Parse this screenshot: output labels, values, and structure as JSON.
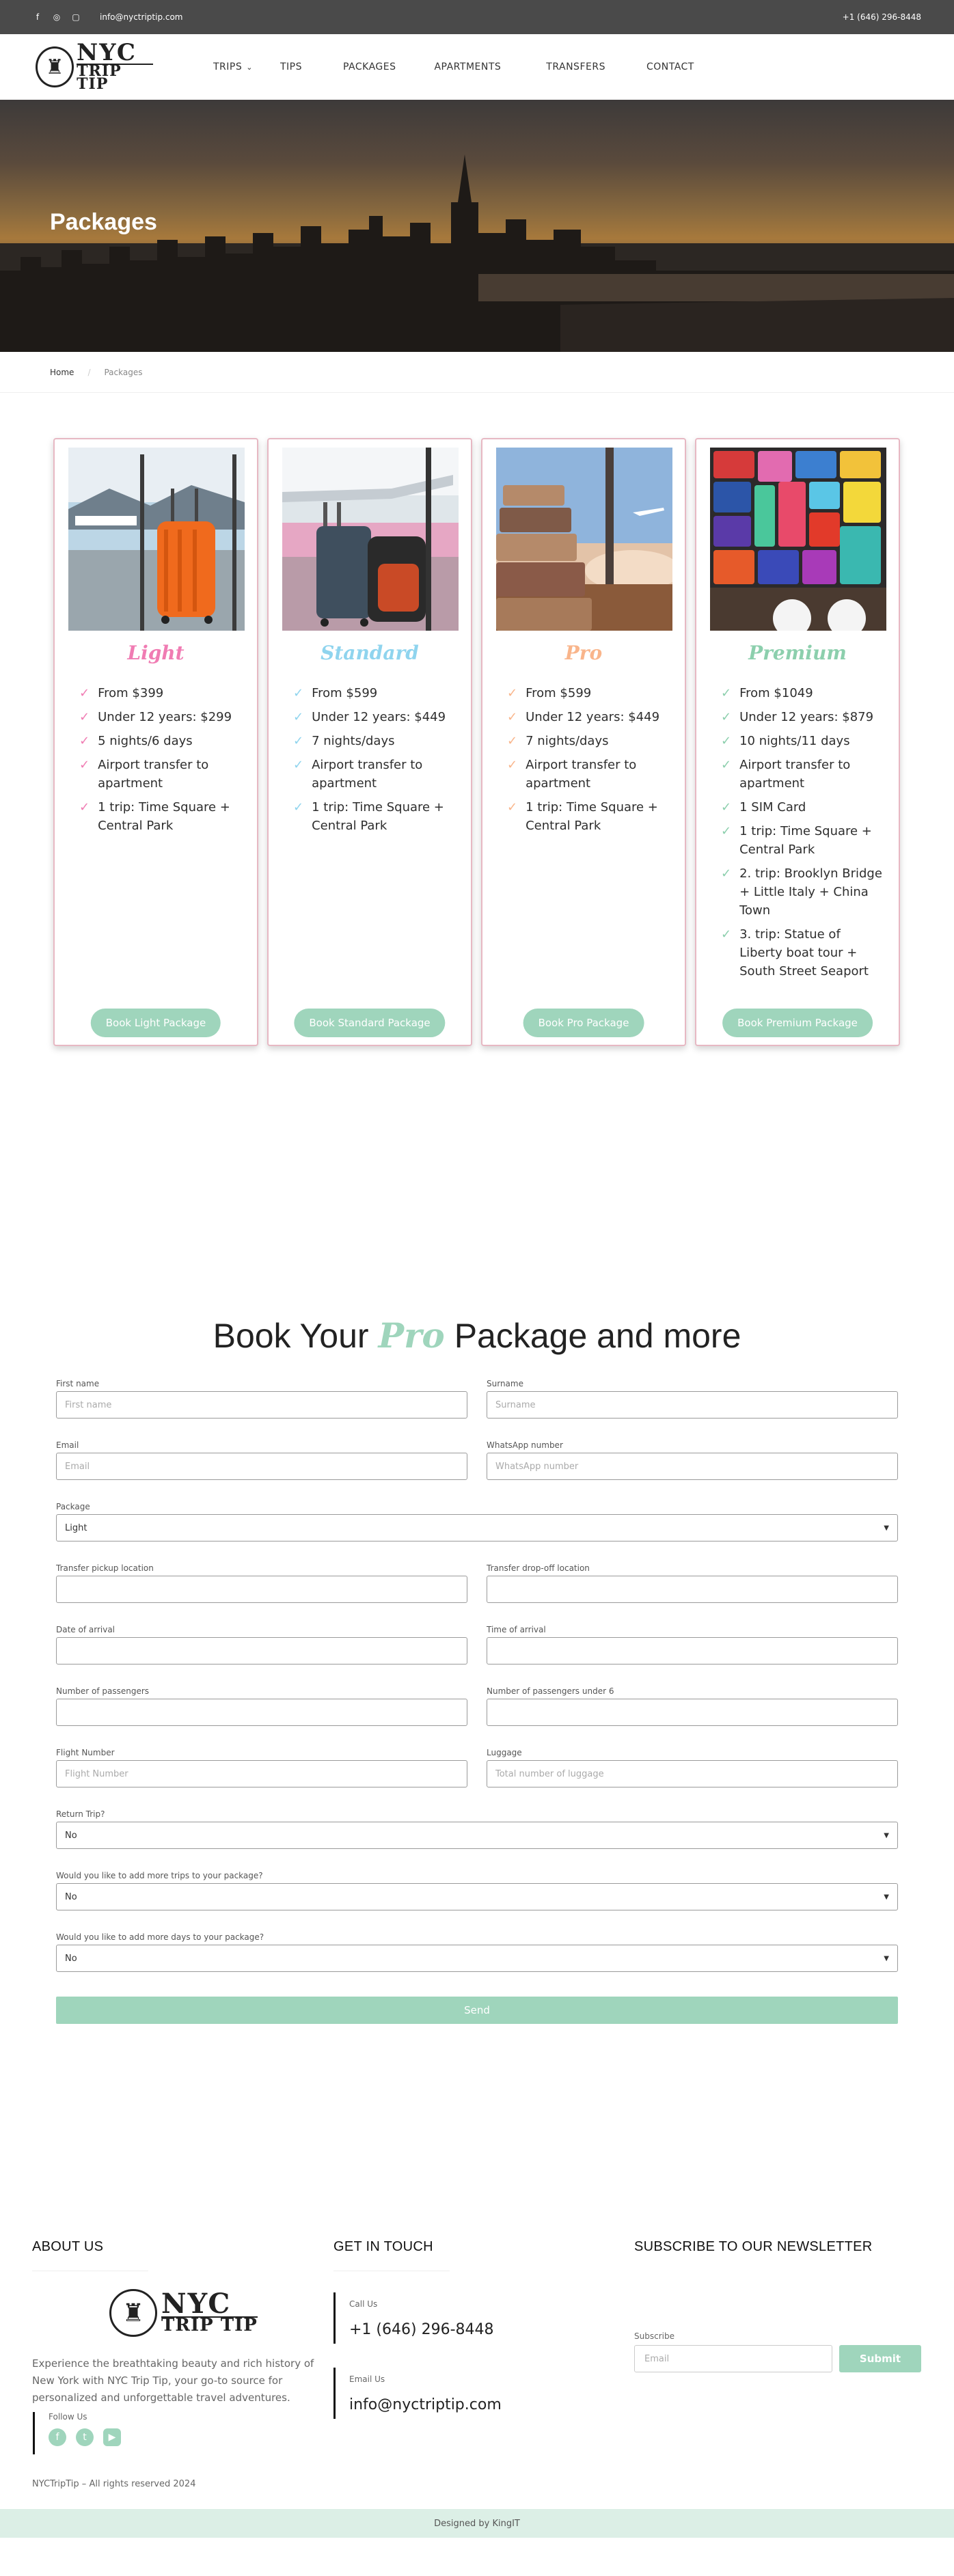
{
  "topbar": {
    "email": "info@nyctriptip.com",
    "phone": "+1 (646) 296-8448",
    "social": [
      "facebook-icon",
      "whatsapp-icon",
      "instagram-icon"
    ]
  },
  "nav": {
    "logo": {
      "line1": "NYC",
      "line2": "TRIP TIP"
    },
    "items": [
      {
        "label": "TRIPS",
        "dropdown": true
      },
      {
        "label": "TIPS"
      },
      {
        "label": "PACKAGES"
      },
      {
        "label": "APARTMENTS"
      },
      {
        "label": "TRANSFERS"
      },
      {
        "label": "CONTACT"
      }
    ]
  },
  "hero": {
    "title": "Packages"
  },
  "breadcrumb": {
    "home": "Home",
    "current": "Packages"
  },
  "colors": {
    "light": "#f07cb3",
    "standard": "#8fd4ee",
    "pro": "#f9b58b",
    "premium": "#8ccfad",
    "accent": "#9fd5bc"
  },
  "packages": [
    {
      "name": "Light",
      "features": [
        "From $399",
        "Under 12 years: $299",
        "5 nights/6 days",
        "Airport transfer to apartment",
        "1 trip: Time Square + Central Park"
      ],
      "button": "Book Light Package"
    },
    {
      "name": "Standard",
      "features": [
        "From $599",
        "Under 12 years: $449",
        "7 nights/days",
        "Airport transfer to apartment",
        "1 trip: Time Square + Central Park"
      ],
      "button": "Book Standard Package"
    },
    {
      "name": "Pro",
      "features": [
        "From $599",
        "Under 12 years: $449",
        "7 nights/days",
        "Airport transfer to apartment",
        "1 trip: Time Square + Central Park"
      ],
      "button": "Book Pro Package"
    },
    {
      "name": "Premium",
      "features": [
        "From $1049",
        "Under 12 years: $879",
        "10 nights/11 days",
        "Airport transfer to apartment",
        "1 SIM Card",
        "1 trip: Time Square + Central Park",
        "2. trip: Brooklyn Bridge + Little Italy + China Town",
        "3. trip: Statue of Liberty boat tour + South Street Seaport"
      ],
      "button": "Book Premium Package"
    }
  ],
  "booking": {
    "heading_pre": "Book Your",
    "heading_pro": "Pro",
    "heading_post": "Package and more",
    "fields": {
      "first_name": {
        "label": "First name",
        "placeholder": "First name"
      },
      "surname": {
        "label": "Surname",
        "placeholder": "Surname"
      },
      "email": {
        "label": "Email",
        "placeholder": "Email"
      },
      "whatsapp": {
        "label": "WhatsApp number",
        "placeholder": "WhatsApp number"
      },
      "package": {
        "label": "Package",
        "value": "Light"
      },
      "pickup": {
        "label": "Transfer pickup location",
        "placeholder": ""
      },
      "dropoff": {
        "label": "Transfer drop-off location",
        "placeholder": ""
      },
      "date_arrival": {
        "label": "Date of arrival",
        "placeholder": ""
      },
      "time_arrival": {
        "label": "Time of arrival",
        "placeholder": ""
      },
      "passengers": {
        "label": "Number of passengers",
        "placeholder": ""
      },
      "passengers_under6": {
        "label": "Number of passengers under 6",
        "placeholder": ""
      },
      "flight": {
        "label": "Flight Number",
        "placeholder": "Flight Number"
      },
      "luggage": {
        "label": "Luggage",
        "placeholder": "Total number of luggage"
      },
      "return_trip": {
        "label": "Return Trip?",
        "value": "No"
      },
      "more_trips": {
        "label": "Would you like to add more trips to your package?",
        "value": "No"
      },
      "more_days": {
        "label": "Would you like to add more days to your package?",
        "value": "No"
      }
    },
    "send": "Send"
  },
  "footer": {
    "about_title": "ABOUT US",
    "contact_title": "GET IN TOUCH",
    "newsletter_title": "SUBSCRIBE TO OUR NEWSLETTER",
    "about_text": "Experience the breathtaking beauty and rich history of New York with NYC Trip Tip, your go-to source for personalized and unforgettable travel adventures.",
    "follow_label": "Follow Us",
    "call_label": "Call Us",
    "phone": "+1 (646) 296-8448",
    "email_label": "Email Us",
    "email": "info@nyctriptip.com",
    "subscribe_label": "Subscribe",
    "subscribe_placeholder": "Email",
    "subscribe_button": "Submit",
    "copyright": "NYCTripTip – All rights reserved 2024",
    "designed_by": "Designed by KingIT"
  }
}
